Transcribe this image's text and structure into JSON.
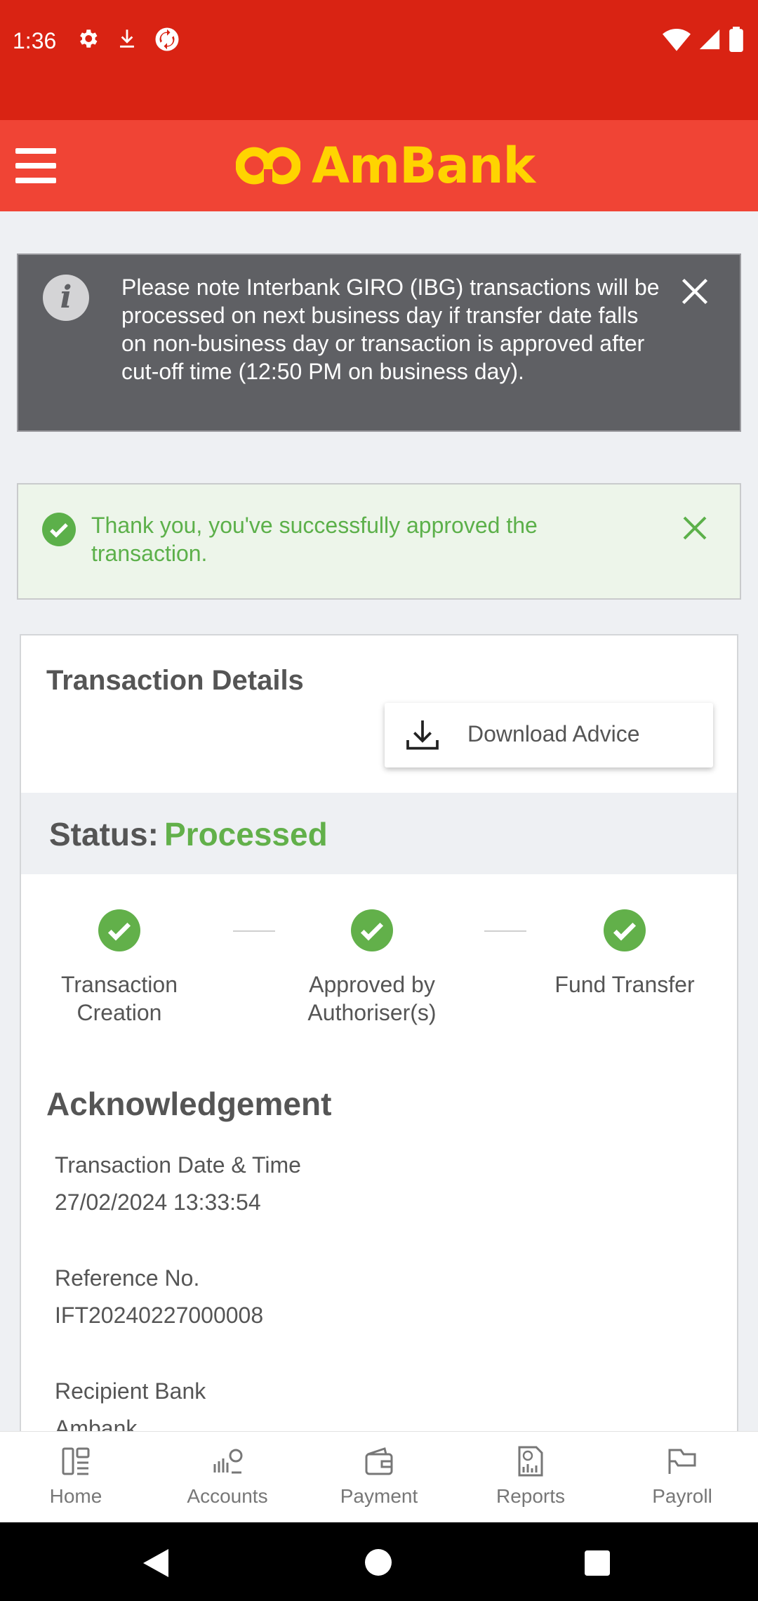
{
  "status_bar": {
    "time": "1:36",
    "left_icons": [
      "settings-icon",
      "download-icon",
      "sync-icon"
    ],
    "right_icons": [
      "wifi-icon",
      "signal-icon",
      "battery-icon"
    ]
  },
  "app_bar": {
    "brand": "AmBank",
    "brand_color": "#ffd400",
    "bar_color": "#f04435"
  },
  "info_banner": {
    "text": "Please note Interbank GIRO (IBG) transactions will be processed on next business day if transfer date falls on non-business day or transaction is approved after cut-off time (12:50 PM on business day).",
    "icon": "info-icon"
  },
  "success_banner": {
    "text": "Thank you, you've successfully approved the transaction.",
    "color": "#5cb04a"
  },
  "card": {
    "title": "Transaction Details",
    "download_label": "Download Advice",
    "status_label": "Status:",
    "status_value": "Processed",
    "steps": [
      {
        "label": "Transaction Creation"
      },
      {
        "label": "Approved by Authoriser(s)"
      },
      {
        "label": "Fund Transfer"
      }
    ],
    "ack_title": "Acknowledgement",
    "fields": [
      {
        "label": "Transaction Date & Time",
        "value": "27/02/2024 13:33:54"
      },
      {
        "label": "Reference No.",
        "value": "IFT20240227000008"
      },
      {
        "label": "Recipient Bank",
        "value": "Ambank"
      }
    ]
  },
  "bottom_nav": [
    {
      "label": "Home",
      "icon": "home-icon"
    },
    {
      "label": "Accounts",
      "icon": "accounts-icon"
    },
    {
      "label": "Payment",
      "icon": "wallet-icon"
    },
    {
      "label": "Reports",
      "icon": "reports-icon"
    },
    {
      "label": "Payroll",
      "icon": "payroll-icon"
    }
  ]
}
